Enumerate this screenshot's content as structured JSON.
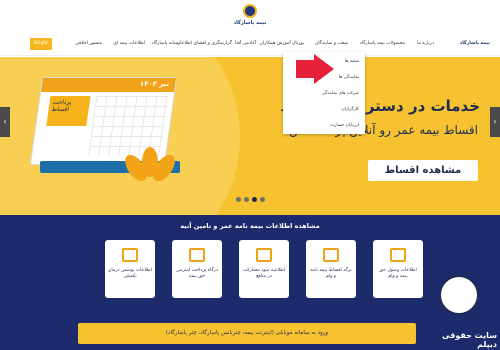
{
  "logo": {
    "text": "بیمه پاسارگاد"
  },
  "nav": {
    "items": [
      "بیمه پاسارگاد",
      "درباره ما",
      "محصولات بیمه پاسارگاد",
      "شعب و نمایندگان",
      "پورتال آموزش همکاران",
      "آکادمی آفتا",
      "گزارشگری و افشای اطلاعات",
      "رسانه پاسارگاد",
      "اطلاعات بیمه ای",
      "منشور اخلاقی"
    ],
    "cta": "Bright"
  },
  "dropdown": {
    "items": [
      "شعبه ها",
      "نمایندگی ها",
      "شرکت های نمایندگی",
      "کارگزاران",
      "ارزیابان خسارت"
    ]
  },
  "hero": {
    "title": "خدمات در دسترس هوشمند",
    "subtitle": "اقساط بیمه عمر رو آنلاین پرداخت کن",
    "button": "مشاهده اقساط",
    "arrow_left": "‹",
    "arrow_right": "›",
    "calendar_month": "تیر ۱۴۰۲",
    "calendar_card": "پرداخت اقساط"
  },
  "info": {
    "title": "مشاهده اطلاعات بیمه نامه عمر و تامین آتیه",
    "cards": [
      {
        "label": "اطلاعات پوشش درمان تکمیلی",
        "icon": "transfer-icon"
      },
      {
        "label": "درگاه پرداخت اینترنتی حق بیمه",
        "icon": "payment-icon"
      },
      {
        "label": "اطلاعیه سود مشارکت در منافع",
        "icon": "document-icon"
      },
      {
        "label": "برگه اقساط بیمه نامه و وام",
        "icon": "sheet-icon"
      },
      {
        "label": "اطلاعات وصول حق بیمه و وام",
        "icon": "receipt-icon"
      }
    ],
    "banner": "ورود به سامانه موبایلی (اینترنت بیمه، چتربانس پاسارگاد، چتر پاسارگاد)"
  },
  "watermark": {
    "text": "سایت حقوقی دیپلم"
  }
}
